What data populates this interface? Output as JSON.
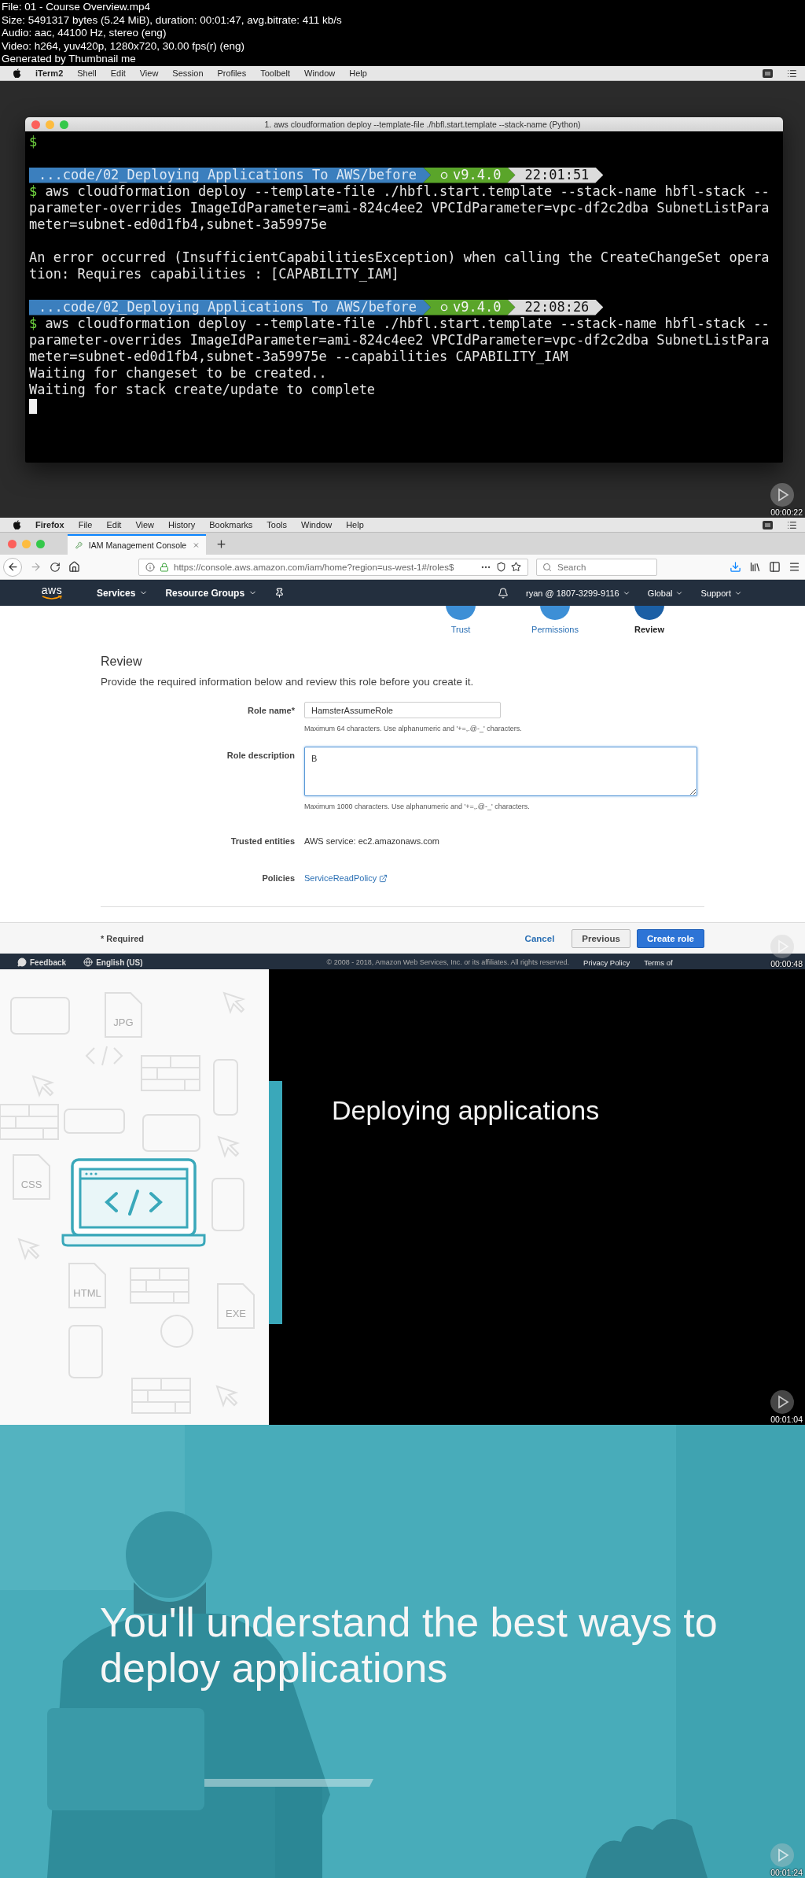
{
  "info_header": [
    "File: 01 - Course Overview.mp4",
    "Size: 5491317 bytes (5.24 MiB), duration: 00:01:47, avg.bitrate: 411 kb/s",
    "Audio: aac, 44100 Hz, stereo (eng)",
    "Video: h264, yuv420p, 1280x720, 30.00 fps(r) (eng)",
    "Generated by Thumbnail me"
  ],
  "frames": [
    {
      "kind": "terminal",
      "menu_bar": {
        "app": "iTerm2",
        "items": [
          "Shell",
          "Edit",
          "View",
          "Session",
          "Profiles",
          "Toolbelt",
          "Window",
          "Help"
        ]
      },
      "window_title": "1. aws cloudformation deploy --template-file ./hbfl.start.template --stack-name  (Python)",
      "lines": [
        {
          "kind": "prompt",
          "prompt": "$"
        },
        {
          "kind": "blank"
        },
        {
          "kind": "powerline",
          "path": "...code/02_Deploying Applications To AWS/before",
          "node": "v9.4.0",
          "time": "22:01:51"
        },
        {
          "kind": "command",
          "prompt": "$",
          "text": "aws cloudformation deploy --template-file ./hbfl.start.template --stack-name hbfl-stack --"
        },
        {
          "kind": "output",
          "text": "parameter-overrides ImageIdParameter=ami-824c4ee2 VPCIdParameter=vpc-df2c2dba SubnetListPara"
        },
        {
          "kind": "output",
          "text": "meter=subnet-ed0d1fb4,subnet-3a59975e"
        },
        {
          "kind": "blank"
        },
        {
          "kind": "output",
          "text": "An error occurred (InsufficientCapabilitiesException) when calling the CreateChangeSet opera"
        },
        {
          "kind": "output",
          "text": "tion: Requires capabilities : [CAPABILITY_IAM]"
        },
        {
          "kind": "blank"
        },
        {
          "kind": "powerline",
          "path": "...code/02_Deploying Applications To AWS/before",
          "node": "v9.4.0",
          "time": "22:08:26"
        },
        {
          "kind": "command",
          "prompt": "$",
          "text": "aws cloudformation deploy --template-file ./hbfl.start.template --stack-name hbfl-stack --"
        },
        {
          "kind": "output",
          "text": "parameter-overrides ImageIdParameter=ami-824c4ee2 VPCIdParameter=vpc-df2c2dba SubnetListPara"
        },
        {
          "kind": "output",
          "text": "meter=subnet-ed0d1fb4,subnet-3a59975e --capabilities CAPABILITY_IAM"
        },
        {
          "kind": "output",
          "text": "Waiting for changeset to be created.."
        },
        {
          "kind": "output",
          "text": "Waiting for stack create/update to complete"
        },
        {
          "kind": "cursor"
        }
      ],
      "timestamp": "00:00:22"
    },
    {
      "kind": "browser",
      "menu_bar": {
        "app": "Firefox",
        "items": [
          "File",
          "Edit",
          "View",
          "History",
          "Bookmarks",
          "Tools",
          "Window",
          "Help"
        ]
      },
      "tabs": [
        {
          "title": "IAM Management Console",
          "selected": true
        }
      ],
      "url": "https://console.aws.amazon.com/iam/home?region=us-west-1#/roles$",
      "search": {
        "placeholder": "Search"
      },
      "aws_nav": {
        "logo": "aws",
        "menus": [
          "Services",
          "Resource Groups"
        ],
        "right": [
          "ryan @ 1807-3299-9116",
          "Global",
          "Support"
        ]
      },
      "steps": [
        {
          "label": "Trust",
          "selected": false
        },
        {
          "label": "Permissions",
          "selected": false
        },
        {
          "label": "Review",
          "selected": true
        }
      ],
      "heading": "Review",
      "intro": "Provide the required information below and review this role before you create it.",
      "form": [
        {
          "kind": "input",
          "label": "Role name*",
          "value": "HamsterAssumeRole",
          "hint": "Maximum 64 characters. Use alphanumeric and '+=,.@-_' characters."
        },
        {
          "kind": "textarea",
          "label": "Role description",
          "value": "B",
          "hint": "Maximum 1000 characters. Use alphanumeric and '+=,.@-_' characters."
        },
        {
          "kind": "text",
          "label": "Trusted entities",
          "value": "AWS service: ec2.amazonaws.com"
        },
        {
          "kind": "link",
          "label": "Policies",
          "value": "ServiceReadPolicy"
        }
      ],
      "required_note": "* Required",
      "buttons": [
        {
          "label": "Cancel",
          "kind": "link"
        },
        {
          "label": "Previous",
          "kind": "secondary"
        },
        {
          "label": "Create role",
          "kind": "primary"
        }
      ],
      "footer": {
        "feedback": "Feedback",
        "language": "English (US)",
        "copyright": "© 2008 - 2018, Amazon Web Services, Inc. or its affiliates. All rights reserved.",
        "links": [
          "Privacy Policy",
          "Terms of"
        ]
      },
      "timestamp": "00:00:48"
    },
    {
      "kind": "slide",
      "title": "Deploying applications",
      "pattern_labels": [
        "JPG",
        "CSS",
        "HTML",
        "EXE"
      ],
      "timestamp": "00:01:04"
    },
    {
      "kind": "photo_slide",
      "caption": "You'll understand the best ways to deploy applications",
      "timestamp": "00:01:24"
    }
  ]
}
